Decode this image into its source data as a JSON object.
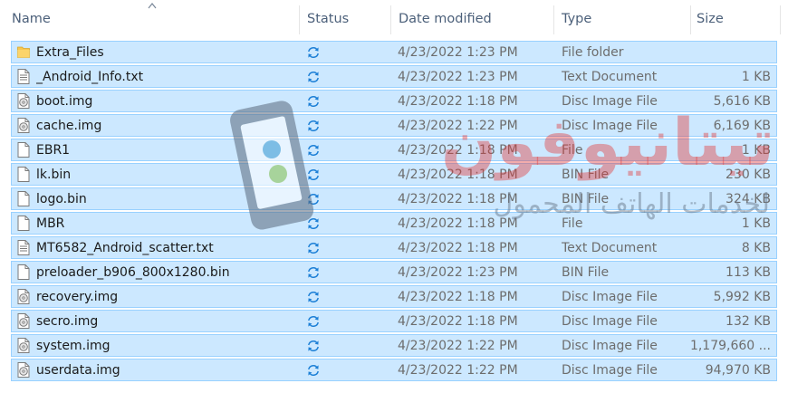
{
  "columns": {
    "name": "Name",
    "status": "Status",
    "date": "Date modified",
    "type": "Type",
    "size": "Size"
  },
  "colors": {
    "selection_bg": "#cce8ff",
    "selection_border": "#99d1ff",
    "header_text": "#4c607a",
    "sync_icon": "#1c7fd6",
    "folder": "#f8c74e"
  },
  "files": [
    {
      "name": "Extra_Files",
      "date": "4/23/2022 1:23 PM",
      "type": "File folder",
      "size": "",
      "icon": "folder-icon"
    },
    {
      "name": "_Android_Info.txt",
      "date": "4/23/2022 1:23 PM",
      "type": "Text Document",
      "size": "1 KB",
      "icon": "text-document-icon"
    },
    {
      "name": "boot.img",
      "date": "4/23/2022 1:18 PM",
      "type": "Disc Image File",
      "size": "5,616 KB",
      "icon": "disc-image-icon"
    },
    {
      "name": "cache.img",
      "date": "4/23/2022 1:22 PM",
      "type": "Disc Image File",
      "size": "6,169 KB",
      "icon": "disc-image-icon"
    },
    {
      "name": "EBR1",
      "date": "4/23/2022 1:18 PM",
      "type": "File",
      "size": "1 KB",
      "icon": "file-icon"
    },
    {
      "name": "lk.bin",
      "date": "4/23/2022 1:18 PM",
      "type": "BIN File",
      "size": "230 KB",
      "icon": "file-icon"
    },
    {
      "name": "logo.bin",
      "date": "4/23/2022 1:18 PM",
      "type": "BIN File",
      "size": "324 KB",
      "icon": "file-icon"
    },
    {
      "name": "MBR",
      "date": "4/23/2022 1:18 PM",
      "type": "File",
      "size": "1 KB",
      "icon": "file-icon"
    },
    {
      "name": "MT6582_Android_scatter.txt",
      "date": "4/23/2022 1:18 PM",
      "type": "Text Document",
      "size": "8 KB",
      "icon": "text-document-icon"
    },
    {
      "name": "preloader_b906_800x1280.bin",
      "date": "4/23/2022 1:23 PM",
      "type": "BIN File",
      "size": "113 KB",
      "icon": "file-icon"
    },
    {
      "name": "recovery.img",
      "date": "4/23/2022 1:18 PM",
      "type": "Disc Image File",
      "size": "5,992 KB",
      "icon": "disc-image-icon"
    },
    {
      "name": "secro.img",
      "date": "4/23/2022 1:18 PM",
      "type": "Disc Image File",
      "size": "132 KB",
      "icon": "disc-image-icon"
    },
    {
      "name": "system.img",
      "date": "4/23/2022 1:22 PM",
      "type": "Disc Image File",
      "size": "1,179,660 ...",
      "icon": "disc-image-icon"
    },
    {
      "name": "userdata.img",
      "date": "4/23/2022 1:22 PM",
      "type": "Disc Image File",
      "size": "94,970 KB",
      "icon": "disc-image-icon"
    }
  ],
  "watermark": {
    "brand": "تيتانيوفون",
    "tagline": "لخدمات الهاتف المحمول"
  }
}
